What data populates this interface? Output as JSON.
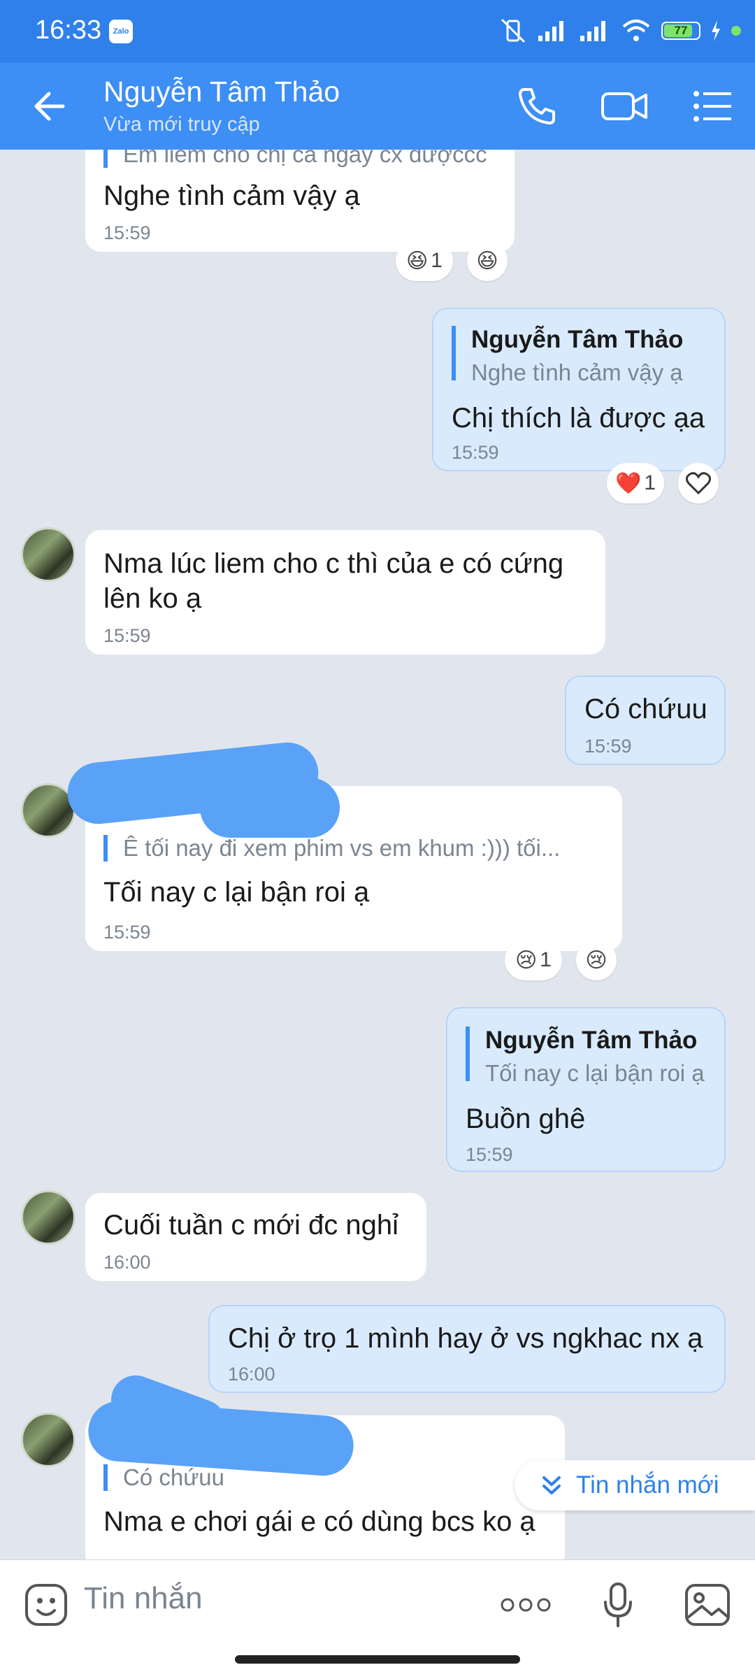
{
  "status_bar": {
    "time": "16:33",
    "app_badge": "Zalo",
    "battery": "77"
  },
  "header": {
    "contact_name": "Nguyễn Tâm Thảo",
    "status": "Vừa mới truy cập"
  },
  "messages": [
    {
      "quote_text": "Em liếm cho chị cả ngày cx đượccc",
      "text": "Nghe tình cảm vậy ạ",
      "time": "15:59",
      "reaction": "😆",
      "reaction_count": "1"
    },
    {
      "quote_name": "Nguyễn Tâm Thảo",
      "quote_text": "Nghe tình cảm vậy ạ",
      "text": "Chị thích là được ạa",
      "time": "15:59",
      "reaction": "❤️",
      "reaction_count": "1"
    },
    {
      "text_line1": "Nma lúc liem cho c thì của e có cứng",
      "text_line2": "lên ko ạ",
      "time": "15:59"
    },
    {
      "text": "Có chứuu",
      "time": "15:59"
    },
    {
      "quote_text": "Ê tối nay đi xem phim vs em khum :))) tối...",
      "text": "Tối nay c lại bận roi ạ",
      "time": "15:59",
      "reaction": "😢",
      "reaction_count": "1"
    },
    {
      "quote_name": "Nguyễn Tâm Thảo",
      "quote_text": "Tối nay c lại bận roi ạ",
      "text": "Buồn ghê",
      "time": "15:59"
    },
    {
      "text": "Cuối tuần c mới đc nghỉ",
      "time": "16:00"
    },
    {
      "text": "Chị ở trọ 1 mình hay ở vs ngkhac nx ạ",
      "time": "16:00"
    },
    {
      "quote_text": "Có chứuu",
      "text": "Nma e chơi gái e có dùng bcs ko ạ"
    }
  ],
  "new_messages_button": "Tin nhắn mới",
  "input": {
    "placeholder": "Tin nhắn"
  }
}
